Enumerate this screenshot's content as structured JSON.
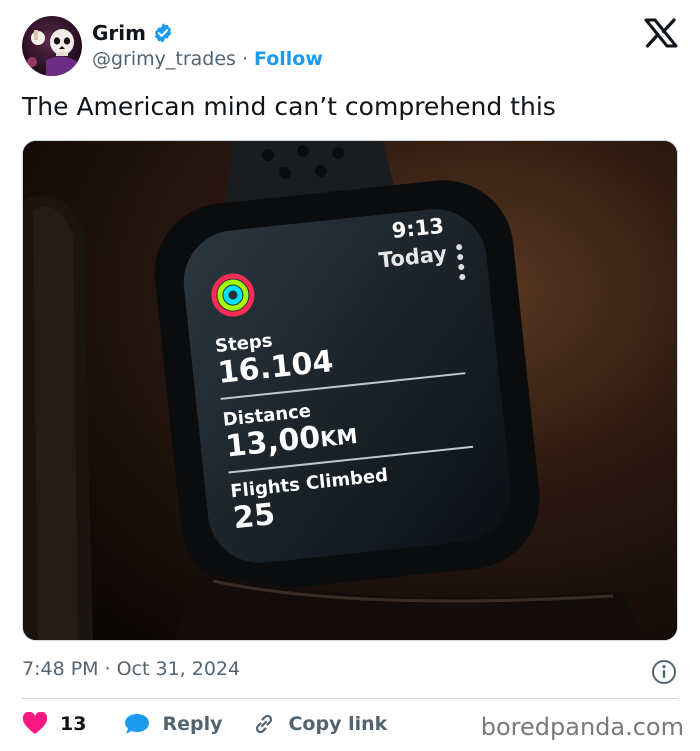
{
  "author": {
    "name": "Grim",
    "handle": "@grimy_trades",
    "separator": "·",
    "follow_label": "Follow",
    "avatar_icon": "skull-avatar-icon",
    "verified_icon": "verified-badge-icon",
    "verified_color": "#1d9bf0"
  },
  "tweet": {
    "text": "The American mind can’t comprehend this"
  },
  "watch": {
    "time": "9:13",
    "day": "Today",
    "stats": [
      {
        "label": "Steps",
        "value": "16.104",
        "unit": ""
      },
      {
        "label": "Distance",
        "value": "13,00",
        "unit": "KM"
      },
      {
        "label": "Flights Climbed",
        "value": "25",
        "unit": ""
      }
    ],
    "ring_colors": [
      "#ff2d55",
      "#a6ff00",
      "#00e0ff"
    ]
  },
  "meta": {
    "time": "7:48 PM",
    "separator": "·",
    "date": "Oct 31, 2024"
  },
  "actions": {
    "like_count": "13",
    "reply_label": "Reply",
    "copy_label": "Copy link",
    "like_color": "#f91880",
    "reply_color": "#1d9bf0"
  },
  "watermark": "boredpanda.com",
  "accent": "#1d9bf0"
}
